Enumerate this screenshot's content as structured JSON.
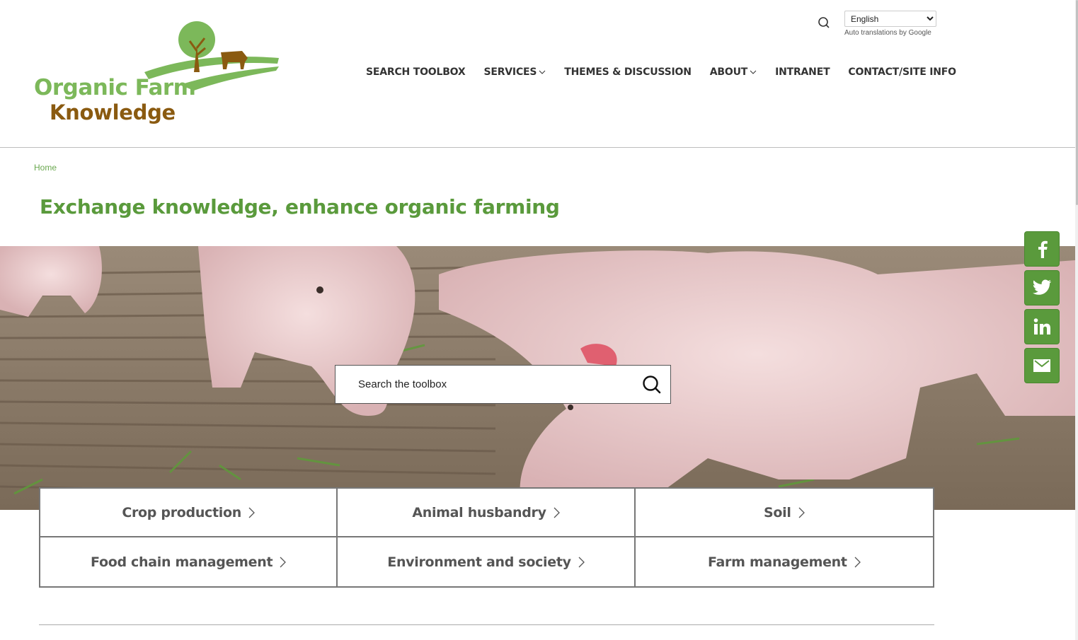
{
  "brand": {
    "name_line1": "Organic Farm",
    "name_line2": "Knowledge"
  },
  "header": {
    "search_icon": "search-icon",
    "language_selected": "English",
    "language_note": "Auto translations by Google"
  },
  "nav": {
    "items": [
      {
        "label": "SEARCH TOOLBOX",
        "has_dropdown": false
      },
      {
        "label": "SERVICES",
        "has_dropdown": true
      },
      {
        "label": "THEMES & DISCUSSION",
        "has_dropdown": false
      },
      {
        "label": "ABOUT",
        "has_dropdown": true
      },
      {
        "label": "INTRANET",
        "has_dropdown": false
      },
      {
        "label": "CONTACT/SITE INFO",
        "has_dropdown": false
      }
    ]
  },
  "breadcrumb": {
    "home": "Home"
  },
  "page": {
    "title": "Exchange knowledge, enhance organic farming"
  },
  "hero_search": {
    "placeholder": "Search the toolbox",
    "icon": "search-icon"
  },
  "social": [
    "facebook-icon",
    "twitter-icon",
    "linkedin-icon",
    "mail-icon"
  ],
  "topics": [
    {
      "label": "Crop production"
    },
    {
      "label": "Animal husbandry"
    },
    {
      "label": "Soil"
    },
    {
      "label": "Food chain management"
    },
    {
      "label": "Environment and society"
    },
    {
      "label": "Farm management"
    }
  ],
  "colors": {
    "brand_green": "#5a9a3c",
    "logo_green": "#7cb85a",
    "logo_brown": "#8a5a10"
  }
}
